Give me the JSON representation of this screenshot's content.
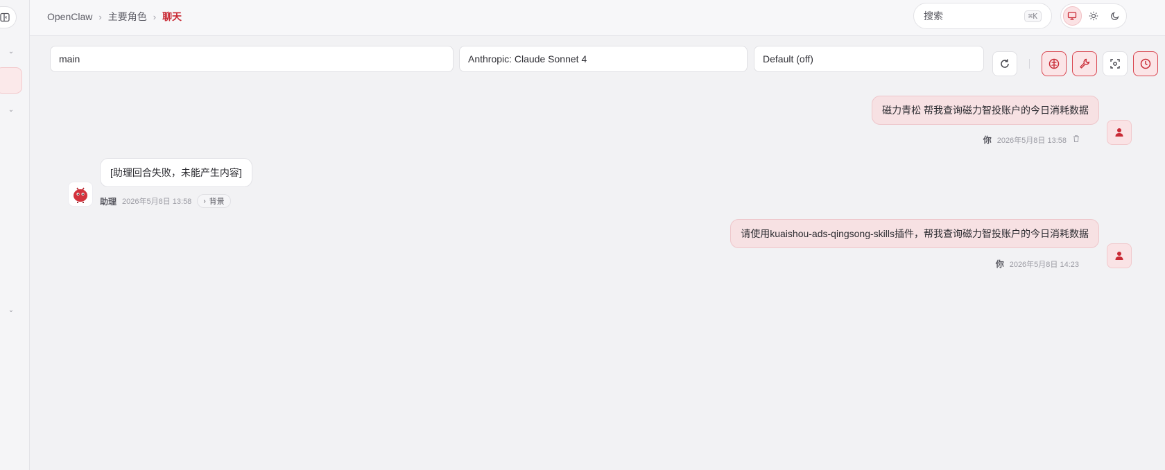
{
  "breadcrumb": {
    "root": "OpenClaw",
    "section": "主要角色",
    "current": "聊天",
    "separator": "›"
  },
  "search": {
    "label": "搜索",
    "shortcut": "⌘K"
  },
  "theme": {
    "options": [
      "system",
      "light",
      "dark"
    ],
    "selected": "system"
  },
  "controls": {
    "session": "main",
    "model": "Anthropic: Claude Sonnet 4",
    "thinking": "Default (off)",
    "buttons": [
      "refresh-icon",
      "brain-icon",
      "wrench-icon",
      "focus-icon",
      "clock-icon"
    ]
  },
  "messages": [
    {
      "role": "user",
      "text": "磁力青松 帮我查询磁力智投账户的今日消耗数据",
      "author": "你",
      "time": "2026年5月8日 13:58"
    },
    {
      "role": "assistant",
      "text": "[助理回合失败，未能产生内容]",
      "author": "助理",
      "time": "2026年5月8日 13:58",
      "context_label": "背景"
    },
    {
      "role": "user",
      "text": "请使用kuaishou-ads-qingsong-skills插件，帮我查询磁力智投账户的今日消耗数据",
      "author": "你",
      "time": "2026年5月8日 14:23"
    }
  ],
  "colors": {
    "accent": "#c92a35",
    "user_bubble": "#f7e1e3",
    "background": "#f2f2f4"
  }
}
